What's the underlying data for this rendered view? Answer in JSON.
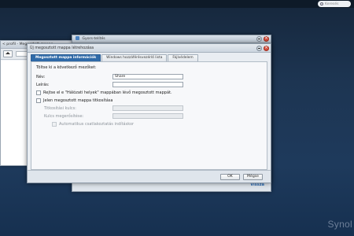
{
  "topbar": {
    "search_placeholder": "Keresés"
  },
  "brand": "Synol",
  "background_window": {
    "title": "< profil - Megosztott mappa"
  },
  "wizard_window": {
    "title": "Gyors-telítés",
    "back_link": "Vissza"
  },
  "dialog": {
    "title": "Új megosztott mappa létrehozása",
    "tabs": [
      {
        "label": "Megosztott mappa információk",
        "active": true
      },
      {
        "label": "Windows hozzáférésvezérlő lista",
        "active": false
      },
      {
        "label": "Fájlvédelem",
        "active": false
      }
    ],
    "form": {
      "intro": "Töltse ki a következő mezőket:",
      "name_label": "Név:",
      "name_value": "Share",
      "description_label": "Leírás:",
      "description_value": "",
      "hide_checkbox_label": "Rejtse el e \"Hálózati helyek\" mappában lévő megosztott mappát.",
      "hide_checkbox_checked": false,
      "encrypt_checkbox_label": "Jelen megosztott mappa titkosítása",
      "encrypt_checkbox_checked": false,
      "encryption_key_label": "Titkosítási kulcs:",
      "confirm_key_label": "Kulcs megerősítése:",
      "auto_mount_label": "Automatikus csatlakoztatás indításkor"
    },
    "buttons": {
      "ok": "OK",
      "cancel": "Mégse"
    }
  }
}
